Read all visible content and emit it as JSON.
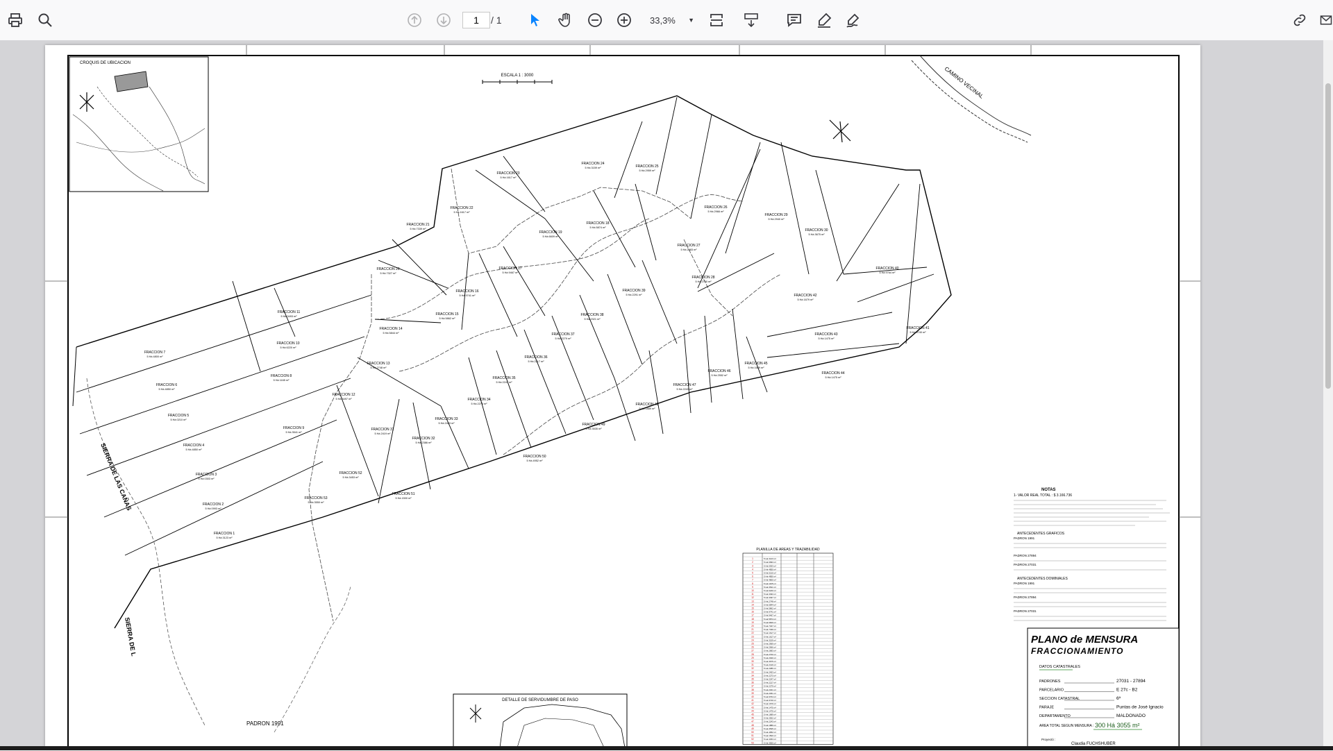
{
  "toolbar": {
    "page_current": "1",
    "page_total": "/ 1",
    "zoom": "33,3%",
    "icons": [
      "print-icon",
      "search-icon",
      "arrow-up-icon",
      "arrow-down-icon",
      "pointer-icon",
      "hand-icon",
      "zoom-out-icon",
      "zoom-in-icon",
      "fit-page-icon",
      "scroll-mode-icon",
      "comment-icon",
      "highlight-icon",
      "sign-icon",
      "share-icon",
      "mail-icon"
    ]
  },
  "plan": {
    "location_title": "CROQUIS DE UBICACION",
    "scale": "ESCALA 1 : 3000",
    "road_label": "CAMINO VECINAL",
    "sierra_label_1": "SIERRA DE LAS CAÑAS",
    "sierra_label_2": "SIERRA DE L",
    "padron_1991": "PADRON 1991",
    "servidumbre_title": "DETALLE DE SERVIDUMBRE DE PASO",
    "table_title": "PLANILLA DE AREAS Y TRAZABILIDAD",
    "fractions": [
      {
        "name": "FRACCION 1",
        "area": "5 Há 3123 m²"
      },
      {
        "name": "FRACCION 2",
        "area": "5 Há 0993 m²"
      },
      {
        "name": "FRACCION 3",
        "area": "5 Há 0303 m²"
      },
      {
        "name": "FRACCION 4",
        "area": "5 Há 4850 m²"
      },
      {
        "name": "FRACCION 5",
        "area": "5 Há 0210 m²"
      },
      {
        "name": "FRACCION 6",
        "area": "5 Há 4850 m²"
      },
      {
        "name": "FRACCION 7",
        "area": "5 Há 4800 m²"
      },
      {
        "name": "FRACCION 8",
        "area": "5 Há 1165 m²"
      },
      {
        "name": "FRACCION 9",
        "area": "5 Há 3541 m²"
      },
      {
        "name": "FRACCION 10",
        "area": "5 Há 6220 m²"
      },
      {
        "name": "FRACCION 11",
        "area": "5 Há 3493 m²"
      },
      {
        "name": "FRACCION 12",
        "area": "5 Há 3497 m²"
      },
      {
        "name": "FRACCION 13",
        "area": "5 Há 2748 m²"
      },
      {
        "name": "FRACCION 14",
        "area": "5 Há 5844 m²"
      },
      {
        "name": "FRACCION 15",
        "area": "5 Há 5862 m²"
      },
      {
        "name": "FRACCION 16",
        "area": "5 Há 9741 m²"
      },
      {
        "name": "FRACCION 17",
        "area": "5 Há 9467 m²"
      },
      {
        "name": "FRACCION 18",
        "area": "5 Há 5874 m²"
      },
      {
        "name": "FRACCION 19",
        "area": "5 Há 6609 m²"
      },
      {
        "name": "FRACCION 20",
        "area": "5 Há 7327 m²"
      },
      {
        "name": "FRACCION 21",
        "area": "5 Há 7339 m²"
      },
      {
        "name": "FRACCION 22",
        "area": "5 Há 1617 m²"
      },
      {
        "name": "FRACCION 23",
        "area": "5 Há 1617 m²"
      },
      {
        "name": "FRACCION 24",
        "area": "5 Há 3159 m²"
      },
      {
        "name": "FRACCION 25",
        "area": "5 Há 2959 m²"
      },
      {
        "name": "FRACCION 26",
        "area": "5 Há 2966 m²"
      },
      {
        "name": "FRACCION 27",
        "area": "5 Há 2683 m²"
      },
      {
        "name": "FRACCION 28",
        "area": "5 Há 2700 m²"
      },
      {
        "name": "FRACCION 29",
        "area": "5 Há 2940 m²"
      },
      {
        "name": "FRACCION 30",
        "area": "5 Há 3675 m²"
      },
      {
        "name": "FRACCION 31",
        "area": "5 Há 2419 m²"
      },
      {
        "name": "FRACCION 32",
        "area": "5 Há 2386 m²"
      },
      {
        "name": "FRACCION 33",
        "area": "5 Há 2453 m²"
      },
      {
        "name": "FRACCION 34",
        "area": "5 Há 2273 m²"
      },
      {
        "name": "FRACCION 35",
        "area": "5 Há 2247 m²"
      },
      {
        "name": "FRACCION 36",
        "area": "5 Há 2217 m²"
      },
      {
        "name": "FRACCION 37",
        "area": "5 Há 2279 m²"
      },
      {
        "name": "FRACCION 38",
        "area": "5 Há 2321 m²"
      },
      {
        "name": "FRACCION 39",
        "area": "5 Há 2291 m²"
      },
      {
        "name": "FRACCION 40",
        "area": "5 Há 9764 m²"
      },
      {
        "name": "FRACCION 41",
        "area": "5 Há 9740 m²"
      },
      {
        "name": "FRACCION 42",
        "area": "5 Há 1679 m²"
      },
      {
        "name": "FRACCION 43",
        "area": "5 Há 1475 m²"
      },
      {
        "name": "FRACCION 44",
        "area": "5 Há 1475 m²"
      },
      {
        "name": "FRACCION 45",
        "area": "5 Há 1689 m²"
      },
      {
        "name": "FRACCION 46",
        "area": "5 Há 2552 m²"
      },
      {
        "name": "FRACCION 47",
        "area": "5 Há 2243 m²"
      },
      {
        "name": "FRACCION 48",
        "area": "5 Há 1889 m²"
      },
      {
        "name": "FRACCION 49",
        "area": "5 Há 3535 m²"
      },
      {
        "name": "FRACCION 50",
        "area": "5 Há 4952 m²"
      },
      {
        "name": "FRACCION 51",
        "area": "5 Há 1500 m²"
      },
      {
        "name": "FRACCION 52",
        "area": "5 Há 3453 m²"
      },
      {
        "name": "FRACCION 53",
        "area": "5 Há 3550 m²"
      }
    ],
    "notes_title": "NOTAS",
    "notes": [
      "1- VALOR REAL TOTAL : $ 3.166.736",
      "ANTECEDENTES GRAFICOS",
      "PADRON 1991",
      "PADRON 27894",
      "PADRON 27031",
      "ANTECEDENTES DOMINIALES",
      "PADRON 1991",
      "PADRON 27894",
      "PADRON 27031"
    ],
    "title_block": {
      "title_line1": "PLANO de MENSURA",
      "title_line2": "FRACCIONAMIENTO",
      "datos": "DATOS CATASTRALES",
      "rows": [
        {
          "label": "PADRONES",
          "value": "27031 - 27894"
        },
        {
          "label": "PARCELARIO",
          "value": "E 27c - B2"
        },
        {
          "label": "SECCION CATASTRAL",
          "value": "6ª"
        },
        {
          "label": "PARAJE",
          "value": "Puntas de José Ignacio"
        },
        {
          "label": "DEPARTAMENTO",
          "value": "MALDONADO"
        }
      ],
      "area_label": "AREA TOTAL SEGUN MENSURA :",
      "area_value": "300 Há 3055 m²",
      "proyecto_label": "Proyectó :",
      "author": "Claudia FUCHSHUBER",
      "signature": "Claudia FUCHSHUBER"
    }
  }
}
